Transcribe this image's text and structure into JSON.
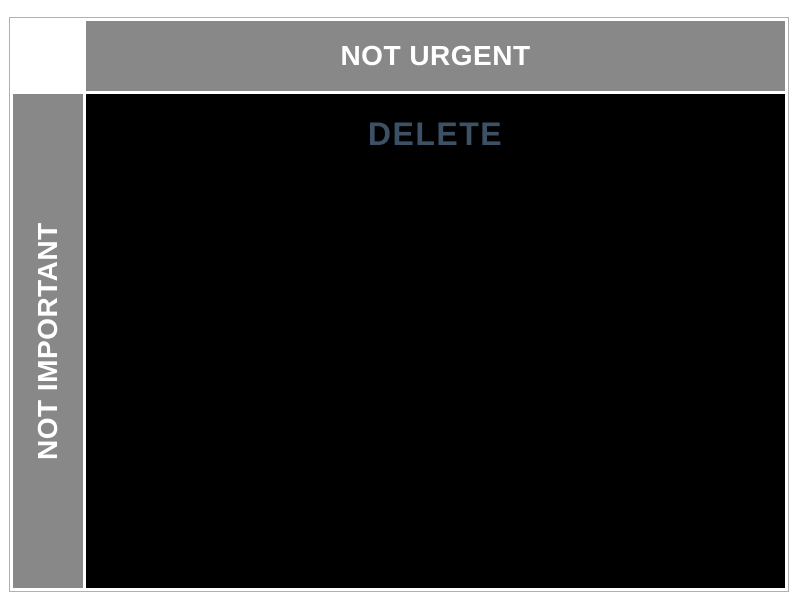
{
  "matrix": {
    "column_header": "NOT URGENT",
    "row_header": "NOT IMPORTANT",
    "quadrant": {
      "title": "DELETE"
    }
  }
}
